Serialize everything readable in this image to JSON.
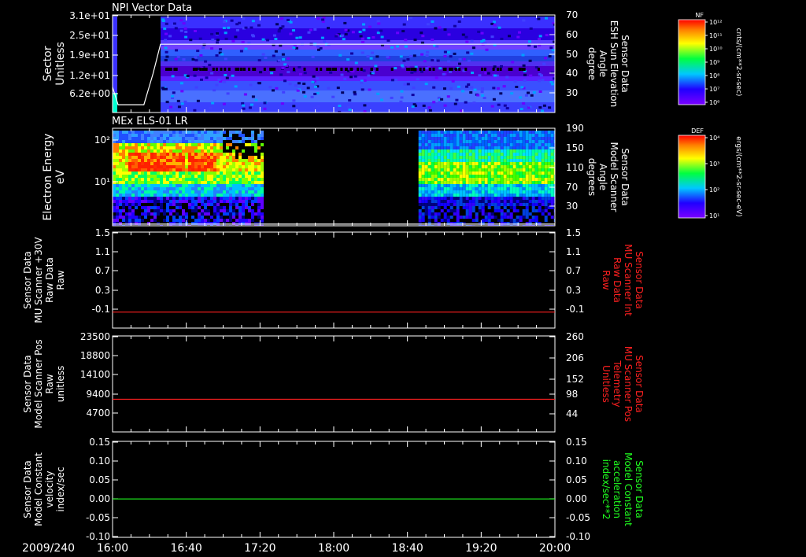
{
  "colors": {
    "background": "#000000",
    "frame": "#ffffff",
    "trace_red": "#ff2020",
    "trace_green": "#20ff20",
    "label_red": "#ff2020",
    "label_green": "#20ff20"
  },
  "time_axis": {
    "date_label": "2009/240",
    "ticks": [
      "16:00",
      "16:40",
      "17:20",
      "18:00",
      "18:40",
      "19:20",
      "20:00"
    ]
  },
  "chart_data": [
    {
      "type": "heatmap",
      "title": "NPI Vector Data",
      "ylabel": [
        "Sector",
        "Unitless"
      ],
      "ylim": [
        0,
        31
      ],
      "yticks": [
        "3.1e+01",
        "2.5e+01",
        "1.9e+01",
        "1.2e+01",
        "6.2e+00"
      ],
      "right_ylabel": [
        "Sensor Data",
        "ESH Sun Elevation",
        "Angle",
        "degree"
      ],
      "right_ylim": [
        20,
        70
      ],
      "right_yticks": [
        "70",
        "60",
        "50",
        "40",
        "30"
      ],
      "overlay_line": {
        "color": "#ffffff",
        "x": [
          "16:00",
          "16:03",
          "16:07",
          "16:17",
          "16:22",
          "16:26",
          "20:00"
        ],
        "y": [
          33,
          24,
          24,
          24,
          40,
          55,
          55
        ]
      },
      "colorbar": {
        "label": "NF",
        "ticks": [
          "10¹²",
          "10¹¹",
          "10¹⁰",
          "10⁹",
          "10⁸",
          "10⁷",
          "10⁶"
        ],
        "units": "cnts/(cm**2-sr-sec)"
      }
    },
    {
      "type": "heatmap",
      "title": "MEx ELS-01 LR",
      "ylabel": [
        "Electron Energy",
        "eV"
      ],
      "ylim": [
        1,
        200
      ],
      "yscale": "log",
      "yticks": [
        "10²",
        "10¹"
      ],
      "right_ylabel": [
        "Sensor Data",
        "Model Scanner",
        "Angle",
        "degrees"
      ],
      "right_ylim": [
        10,
        190
      ],
      "right_yticks": [
        "190",
        "150",
        "110",
        "70",
        "30"
      ],
      "data_gap": [
        "17:21",
        "18:46"
      ],
      "overlay_line": {
        "color": "#ffffff",
        "x": [
          "16:00",
          "20:00"
        ],
        "y": [
          13,
          13
        ]
      },
      "colorbar": {
        "label": "DEF",
        "ticks": [
          "10⁴",
          "10³",
          "10²",
          "10¹"
        ],
        "units": "ergs/(cm**2-sr-sec-eV)"
      }
    },
    {
      "type": "line",
      "ylabel": [
        "Sensor Data",
        "MU Scanner +30V",
        "Raw Data",
        "Raw"
      ],
      "ylim": [
        -0.3,
        1.5
      ],
      "yticks": [
        "1.5",
        "1.1",
        "0.7",
        "0.3",
        "-0.1"
      ],
      "right_ylabel": [
        "Sensor Data",
        "MU Scanner Int",
        "Raw Data",
        "Raw"
      ],
      "right_ylim": [
        -0.3,
        1.5
      ],
      "right_yticks": [
        "1.5",
        "1.1",
        "0.7",
        "0.3",
        "-0.1"
      ],
      "series": [
        {
          "x": [
            "16:00",
            "20:00"
          ],
          "y": [
            0.0,
            0.0
          ],
          "color": "#ff2020"
        }
      ]
    },
    {
      "type": "line",
      "ylabel": [
        "Sensor Data",
        "Model Scanner Pos",
        "Raw",
        "unitless"
      ],
      "ylim": [
        0,
        23500
      ],
      "yticks": [
        "23500",
        "18800",
        "14100",
        "9400",
        "4700"
      ],
      "right_ylabel": [
        "Sensor Data",
        "MU Scanner Pos",
        "Telemetry",
        "Unitless"
      ],
      "right_ylim": [
        0,
        260
      ],
      "right_yticks": [
        "260",
        "206",
        "152",
        "98",
        "44"
      ],
      "series": [
        {
          "x": [
            "16:00",
            "20:00"
          ],
          "y": [
            8000,
            8000
          ],
          "color": "#ff2020"
        }
      ]
    },
    {
      "type": "line",
      "ylabel": [
        "Sensor Data",
        "Model Constant",
        "velocity",
        "index/sec"
      ],
      "ylim": [
        -0.1,
        0.15
      ],
      "yticks": [
        "0.15",
        "0.10",
        "0.05",
        "0.00",
        "-0.05",
        "-0.10"
      ],
      "right_ylabel": [
        "Sensor Data",
        "Model Constant",
        "acceleration",
        "index/sec**2"
      ],
      "right_ylim": [
        -0.1,
        0.15
      ],
      "right_yticks": [
        "0.15",
        "0.10",
        "0.05",
        "0.00",
        "-0.05",
        "-0.10"
      ],
      "series": [
        {
          "x": [
            "16:00",
            "20:00"
          ],
          "y": [
            0.0,
            0.0
          ],
          "color": "#20ff20"
        }
      ]
    }
  ]
}
